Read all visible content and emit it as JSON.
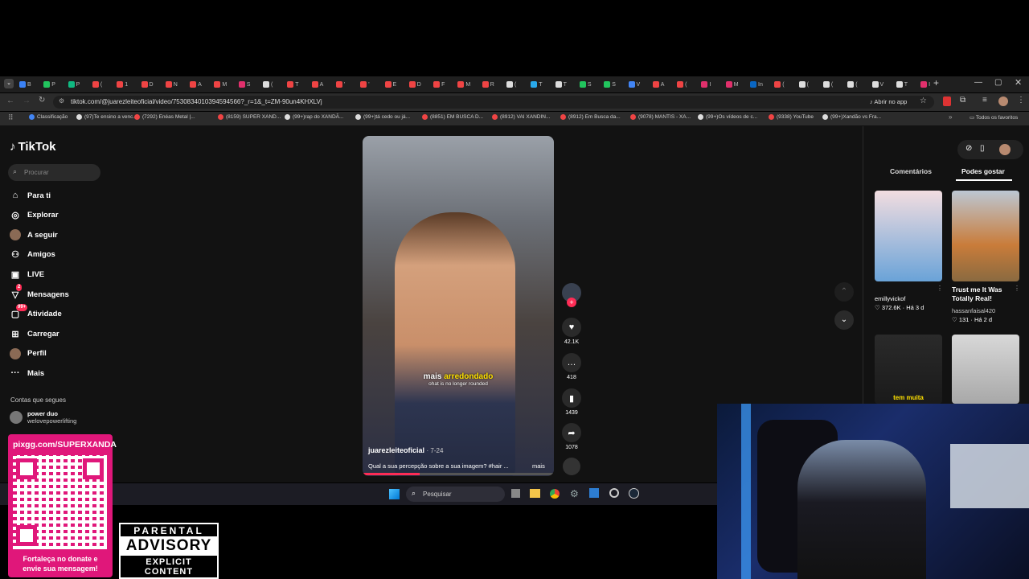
{
  "browser": {
    "url": "tiktok.com/@juarezleiteoficial/video/7530834010394594566?_r=1&_t=ZM-90un4KHXLVj",
    "open_in_app": "Abrir no app",
    "all_bookmarks": "Todos os favoritos",
    "tabs": [
      "B",
      "P",
      "P",
      "(",
      "1",
      "D",
      "N",
      "A",
      "M",
      "S",
      "(",
      "T",
      "A",
      "'",
      "'",
      "E",
      "D",
      "F",
      "M",
      "R",
      "(",
      "T",
      "T",
      "S",
      "S",
      "V",
      "A",
      "(",
      "I",
      "M",
      "In",
      "(",
      "(",
      "(",
      "(",
      "V",
      "T",
      "I"
    ],
    "bookmarks": [
      "Classificação",
      "(97)Te ensino a venc...",
      "(7292) Enéas Metal |...",
      "(8159) SUPER XAND...",
      "(99+)rap do XANDÃ...",
      "(99+)tá cedo ou já...",
      "(8851) EM BUSCA D...",
      "(8912) VAI XANDIN...",
      "(8912) Em Busca da...",
      "(9078) MANTIS - XA...",
      "(99+)Os vídeos de c...",
      "(9338) YouTube",
      "(99+)Xandão vs Fra..."
    ]
  },
  "tiktok": {
    "logo": "TikTok",
    "search_placeholder": "Procurar",
    "nav": [
      {
        "label": "Para ti",
        "icon": "home-icon"
      },
      {
        "label": "Explorar",
        "icon": "compass-icon"
      },
      {
        "label": "A seguir",
        "icon": "avatar-icon"
      },
      {
        "label": "Amigos",
        "icon": "friends-icon"
      },
      {
        "label": "LIVE",
        "icon": "live-icon"
      },
      {
        "label": "Mensagens",
        "icon": "message-icon",
        "badge": "2"
      },
      {
        "label": "Atividade",
        "icon": "activity-icon",
        "badge": "99+"
      },
      {
        "label": "Carregar",
        "icon": "upload-icon"
      },
      {
        "label": "Perfil",
        "icon": "profile-icon"
      },
      {
        "label": "Mais",
        "icon": "more-icon"
      }
    ],
    "following_heading": "Contas que segues",
    "following": [
      {
        "name": "power duo",
        "handle": "welovepowerlifting"
      }
    ],
    "video": {
      "caption_main": "mais",
      "caption_highlight": "arredondado",
      "caption_sub": "ohat is no longer rounded",
      "author": "juarezleiteoficial",
      "date": "· 7-24",
      "description": "Qual a sua percepção sobre a sua imagem? #hair ...",
      "more": "mais"
    },
    "actions": {
      "likes": "42.1K",
      "comments": "418",
      "saves": "1439",
      "shares": "1078"
    },
    "right_tabs": [
      "Comentários",
      "Podes gostar"
    ],
    "suggestions": [
      {
        "author": "emillyvickof",
        "likes": "372.6K",
        "time": "Há 3 d",
        "title": ""
      },
      {
        "author": "hassanfaisal420",
        "likes": "131",
        "time": "Há 2 d",
        "title": "Trust me It Was Totally Real!"
      },
      {
        "author": "",
        "likes": "",
        "time": "",
        "title": "tem muita"
      },
      {
        "author": "",
        "likes": "",
        "time": "",
        "title": ""
      }
    ]
  },
  "taskbar": {
    "search_placeholder": "Pesquisar"
  },
  "overlay": {
    "donate_url": "pixgg.com/SUPERXANDA",
    "donate_text": "Fortaleça no donate e envie sua mensagem!",
    "advisory_top": "PARENTAL",
    "advisory_mid": "ADVISORY",
    "advisory_bottom": "EXPLICIT CONTENT"
  },
  "colors": {
    "accent": "#fe2c55",
    "caption_yellow": "#ffe100",
    "donate_pink": "#e0177a"
  }
}
